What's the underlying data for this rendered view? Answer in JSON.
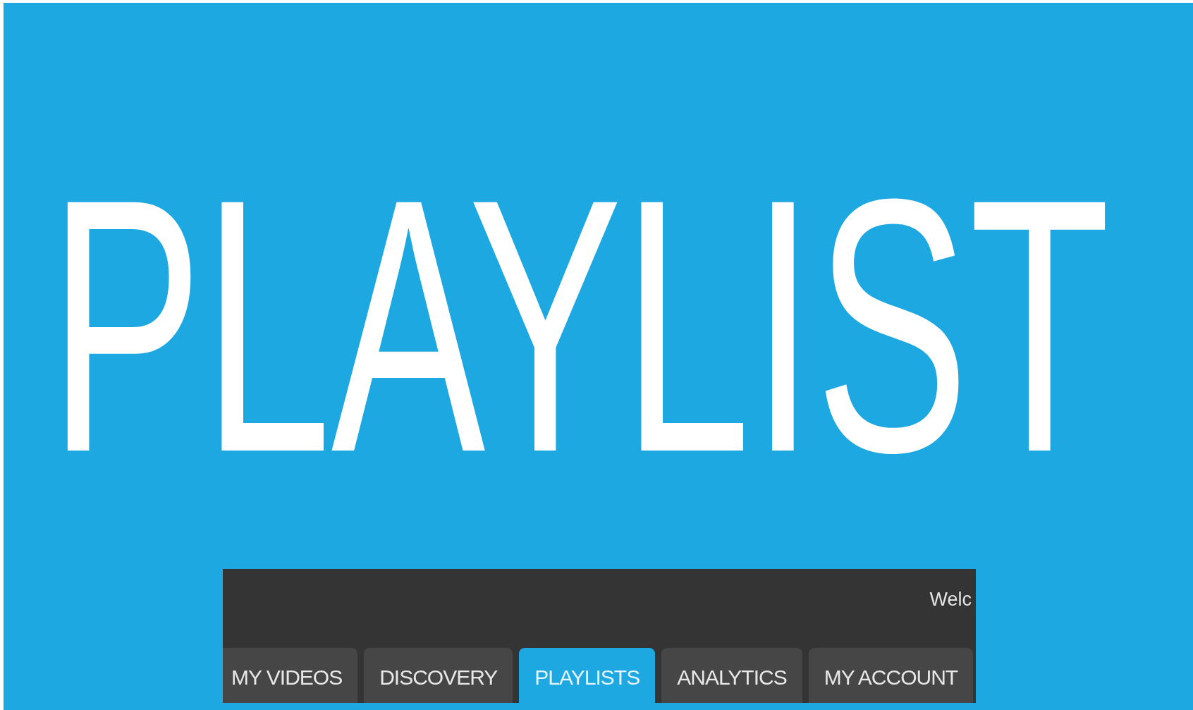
{
  "heading": "PLAYLIST",
  "header": {
    "welcome": "Welc"
  },
  "tabs": [
    {
      "label": "MY VIDEOS",
      "selected": false
    },
    {
      "label": "DISCOVERY",
      "selected": false
    },
    {
      "label": "PLAYLISTS",
      "selected": true
    },
    {
      "label": "ANALYTICS",
      "selected": false
    },
    {
      "label": "MY ACCOUNT",
      "selected": false
    }
  ]
}
